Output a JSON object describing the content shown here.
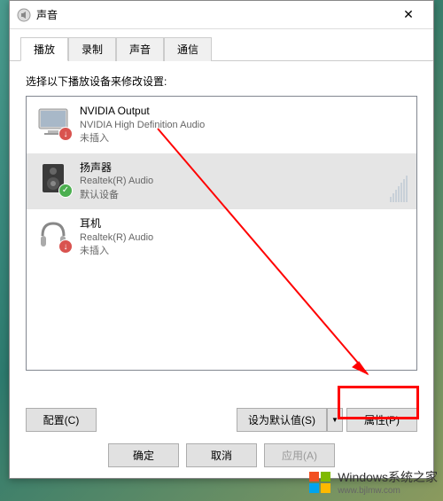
{
  "window": {
    "title": "声音"
  },
  "tabs": [
    {
      "label": "播放",
      "active": true
    },
    {
      "label": "录制",
      "active": false
    },
    {
      "label": "声音",
      "active": false
    },
    {
      "label": "通信",
      "active": false
    }
  ],
  "instruction": "选择以下播放设备来修改设置:",
  "devices": [
    {
      "name": "NVIDIA Output",
      "driver": "NVIDIA High Definition Audio",
      "status": "未插入",
      "selected": false,
      "icon": "monitor",
      "badge": "unplugged"
    },
    {
      "name": "扬声器",
      "driver": "Realtek(R) Audio",
      "status": "默认设备",
      "selected": true,
      "icon": "speaker",
      "badge": "default"
    },
    {
      "name": "耳机",
      "driver": "Realtek(R) Audio",
      "status": "未插入",
      "selected": false,
      "icon": "headphones",
      "badge": "unplugged"
    }
  ],
  "buttons": {
    "configure": "配置(C)",
    "set_default": "设为默认值(S)",
    "properties": "属性(P)",
    "ok": "确定",
    "cancel": "取消",
    "apply": "应用(A)"
  },
  "watermark": {
    "brand": "Windows",
    "suffix": "系统之家",
    "url": "www.bjlmw.com"
  },
  "highlight": {
    "target": "properties-button"
  }
}
